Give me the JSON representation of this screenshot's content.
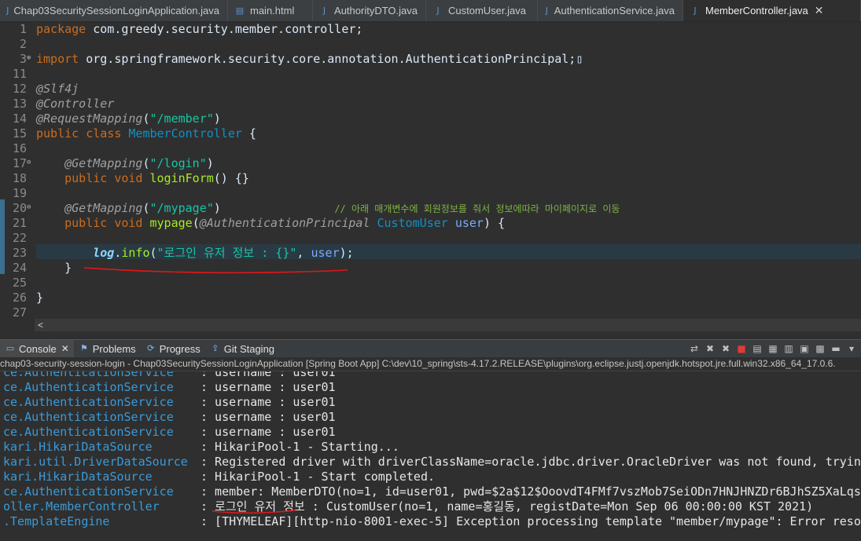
{
  "tabs": [
    {
      "label": "Chap03SecuritySessionLoginApplication.java",
      "icon": "java-file-icon",
      "active": false
    },
    {
      "label": "main.html",
      "icon": "html-file-icon",
      "active": false
    },
    {
      "label": "AuthorityDTO.java",
      "icon": "java-file-icon",
      "active": false
    },
    {
      "label": "CustomUser.java",
      "icon": "java-file-icon",
      "active": false
    },
    {
      "label": "AuthenticationService.java",
      "icon": "java-file-icon",
      "active": false
    },
    {
      "label": "MemberController.java",
      "icon": "java-file-icon",
      "active": true
    }
  ],
  "editor": {
    "lines": [
      {
        "n": "1",
        "fold": "",
        "t": [
          [
            "kw",
            "package"
          ],
          [
            "pl",
            " com.greedy.security.member.controller;"
          ]
        ]
      },
      {
        "n": "2",
        "fold": "",
        "t": []
      },
      {
        "n": "3",
        "fold": "⊕",
        "t": [
          [
            "kw",
            "import"
          ],
          [
            "pl",
            " org.springframework.security.core.annotation.AuthenticationPrincipal;"
          ],
          [
            "pl",
            "▯"
          ]
        ]
      },
      {
        "n": "11",
        "fold": "",
        "t": []
      },
      {
        "n": "12",
        "fold": "",
        "t": [
          [
            "ann",
            "@Slf4j"
          ]
        ]
      },
      {
        "n": "13",
        "fold": "",
        "t": [
          [
            "ann",
            "@Controller"
          ]
        ]
      },
      {
        "n": "14",
        "fold": "",
        "t": [
          [
            "ann",
            "@RequestMapping"
          ],
          [
            "pl",
            "("
          ],
          [
            "str",
            "\"/member\""
          ],
          [
            "pl",
            ")"
          ]
        ]
      },
      {
        "n": "15",
        "fold": "",
        "t": [
          [
            "kw",
            "public class "
          ],
          [
            "cls",
            "MemberController"
          ],
          [
            "pl",
            " {"
          ]
        ]
      },
      {
        "n": "16",
        "fold": "",
        "t": []
      },
      {
        "n": "17",
        "fold": "⊖",
        "t": [
          [
            "pl",
            "    "
          ],
          [
            "ann",
            "@GetMapping"
          ],
          [
            "pl",
            "("
          ],
          [
            "str",
            "\"/login\""
          ],
          [
            "pl",
            ")"
          ]
        ]
      },
      {
        "n": "18",
        "fold": "",
        "t": [
          [
            "pl",
            "    "
          ],
          [
            "kw",
            "public void "
          ],
          [
            "mth",
            "loginForm"
          ],
          [
            "pl",
            "() {}"
          ]
        ]
      },
      {
        "n": "19",
        "fold": "",
        "t": []
      },
      {
        "n": "20",
        "fold": "⊖",
        "t": [
          [
            "pl",
            "    "
          ],
          [
            "ann",
            "@GetMapping"
          ],
          [
            "pl",
            "("
          ],
          [
            "str",
            "\"/mypage\""
          ],
          [
            "pl",
            ")                "
          ],
          [
            "cmt",
            "// 아래 매개변수에 회원정보를 줘서 정보에따라 마이페이지로 이동"
          ]
        ]
      },
      {
        "n": "21",
        "fold": "",
        "t": [
          [
            "pl",
            "    "
          ],
          [
            "kw",
            "public void "
          ],
          [
            "mth",
            "mypage"
          ],
          [
            "pl",
            "("
          ],
          [
            "ann",
            "@AuthenticationPrincipal"
          ],
          [
            "pl",
            " "
          ],
          [
            "cls",
            "CustomUser"
          ],
          [
            "pl",
            " "
          ],
          [
            "var",
            "user"
          ],
          [
            "pl",
            ") {"
          ]
        ]
      },
      {
        "n": "22",
        "fold": "",
        "t": []
      },
      {
        "n": "23",
        "fold": "",
        "t": [
          [
            "pl",
            "        "
          ],
          [
            "logf",
            "log"
          ],
          [
            "pl",
            "."
          ],
          [
            "mth",
            "info"
          ],
          [
            "pl",
            "("
          ],
          [
            "str",
            "\"로그인 유저 정보 : {}\""
          ],
          [
            "pl",
            ", "
          ],
          [
            "var",
            "user"
          ],
          [
            "pl",
            ");"
          ]
        ]
      },
      {
        "n": "24",
        "fold": "",
        "t": [
          [
            "pl",
            "    }"
          ]
        ]
      },
      {
        "n": "25",
        "fold": "",
        "t": []
      },
      {
        "n": "26",
        "fold": "",
        "t": [
          [
            "pl",
            "}"
          ]
        ]
      },
      {
        "n": "27",
        "fold": "",
        "t": []
      }
    ],
    "scroll_left_label": "<"
  },
  "console": {
    "tabs": [
      {
        "label": "Console",
        "icon": "console-icon",
        "active": true,
        "closable": true
      },
      {
        "label": "Problems",
        "icon": "problems-icon",
        "active": false
      },
      {
        "label": "Progress",
        "icon": "progress-icon",
        "active": false
      },
      {
        "label": "Git Staging",
        "icon": "git-staging-icon",
        "active": false
      }
    ],
    "tab_close": "✕",
    "process": "chap03-security-session-login - Chap03SecuritySessionLoginApplication [Spring Boot App] C:\\dev\\10_spring\\sts-4.17.2.RELEASE\\plugins\\org.eclipse.justj.openjdk.hotspot.jre.full.win32.x86_64_17.0.6.",
    "lines": [
      {
        "src": "ce.AuthenticationService",
        "msg": ": username : user01"
      },
      {
        "src": "ce.AuthenticationService",
        "msg": ": username : user01"
      },
      {
        "src": "ce.AuthenticationService",
        "msg": ": username : user01"
      },
      {
        "src": "ce.AuthenticationService",
        "msg": ": username : user01"
      },
      {
        "src": "ce.AuthenticationService",
        "msg": ": username : user01"
      },
      {
        "src": "kari.HikariDataSource",
        "msg": ": HikariPool-1 - Starting..."
      },
      {
        "src": "kari.util.DriverDataSource",
        "msg": ": Registered driver with driverClassName=oracle.jdbc.driver.OracleDriver was not found, trying"
      },
      {
        "src": "kari.HikariDataSource",
        "msg": ": HikariPool-1 - Start completed."
      },
      {
        "src": "ce.AuthenticationService",
        "msg": ": member: MemberDTO(no=1, id=user01, pwd=$2a$12$OoovdT4FMf7vszMob7SeiODn7HNJHNZDr6BJhSZ5XaLqs/"
      },
      {
        "src": "oller.MemberController",
        "msg": ": 로그인 유저 정보 : CustomUser(no=1, name=홍길동, registDate=Mon Sep 06 00:00:00 KST 2021)"
      },
      {
        "src": ".TemplateEngine",
        "msg": ": [THYMELEAF][http-nio-8001-exec-5] Exception processing template \"member/mypage\": Error resol"
      }
    ]
  },
  "colors": {
    "underline": "#e01818",
    "editor_bg": "#2f2f2f"
  }
}
